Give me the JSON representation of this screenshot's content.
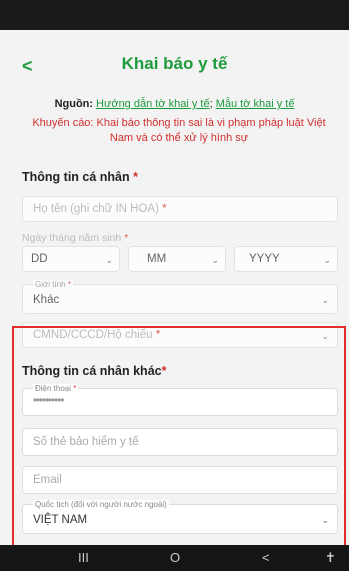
{
  "header": {
    "back_glyph": "<",
    "title": "Khai báo y tế"
  },
  "source": {
    "label": "Nguồn:",
    "link1": "Hướng dẫn tờ khai y tế",
    "separator": ";",
    "link2": "Mẫu tờ khai y tế"
  },
  "warning": "Khuyến cáo: Khai báo thông tin sai là vi phạm pháp luật Việt Nam và có thể xử lý hình sự",
  "personal": {
    "section_title": "Thông tin cá nhân",
    "required_mark": "*",
    "full_name_placeholder": "Họ tên (ghi chữ IN HOA)",
    "dob_label": "Ngày tháng năm sinh",
    "day": "DD",
    "month": "MM",
    "year": "YYYY",
    "gender_label": "Giới tính",
    "gender_value": "Khác",
    "id_placeholder": "CMND/CCCD/Hộ chiếu"
  },
  "other": {
    "section_title": "Thông tin cá nhân khác",
    "required_mark": "*",
    "phone_label": "Điện thoại",
    "phone_value": "••••••••••",
    "insurance_placeholder": "Số thẻ bảo hiểm y tế",
    "email_placeholder": "Email",
    "nationality_label": "Quốc tịch (đối với người nước ngoài)",
    "nationality_value": "VIỆT NAM"
  },
  "navbar": {
    "recents": "III",
    "home": "O",
    "back": "<",
    "accessibility": "✝"
  },
  "colors": {
    "brand_green": "#1e9b3c",
    "warning_red": "#d03030",
    "highlight_red": "#e0302a"
  }
}
